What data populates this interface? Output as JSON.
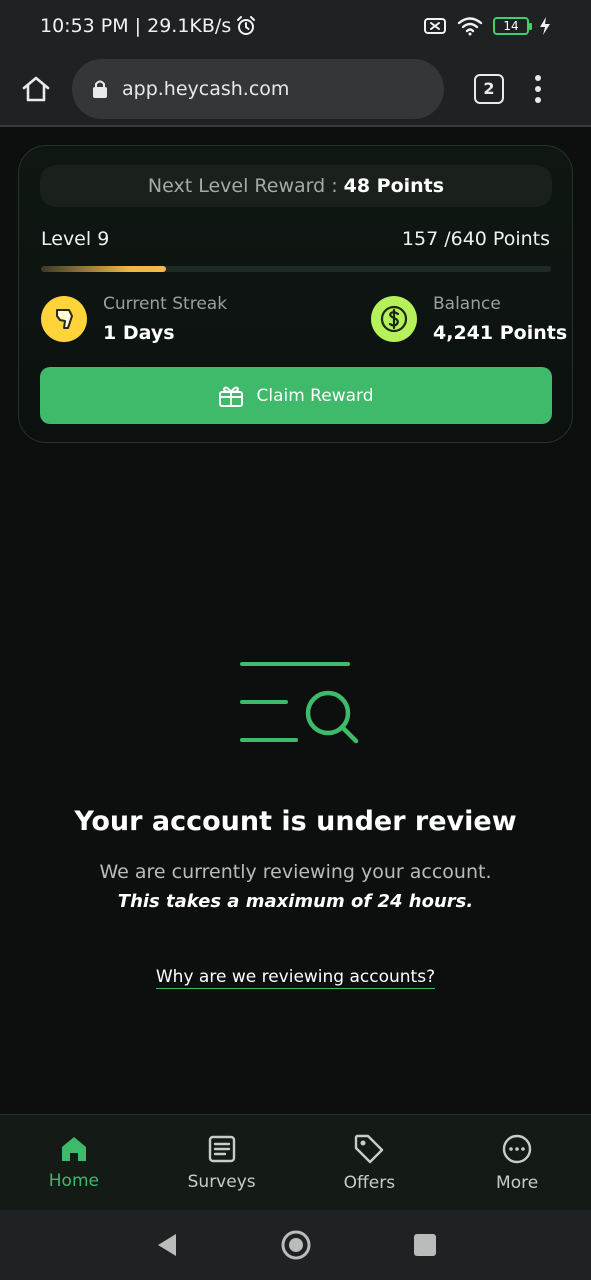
{
  "status_bar": {
    "time_speed": "10:53 PM | 29.1KB/s",
    "battery_level": "14"
  },
  "browser": {
    "url": "app.heycash.com",
    "tab_count": "2"
  },
  "reward_card": {
    "next_level_label": "Next Level Reward :",
    "next_level_value": "48 Points",
    "level_label": "Level 9",
    "level_points": "157 /640 Points",
    "progress_fraction": 0.245,
    "streak_label": "Current Streak",
    "streak_value": "1 Days",
    "balance_label": "Balance",
    "balance_value": "4,241 Points",
    "claim_button": "Claim Reward"
  },
  "review": {
    "title": "Your account is under review",
    "description": "We are currently reviewing your account.",
    "note": "This takes a maximum of 24 hours.",
    "link": "Why are we reviewing accounts?"
  },
  "bottom_nav": {
    "items": [
      {
        "label": "Home",
        "icon": "home-icon",
        "active": true
      },
      {
        "label": "Surveys",
        "icon": "document-icon",
        "active": false
      },
      {
        "label": "Offers",
        "icon": "tag-icon",
        "active": false
      },
      {
        "label": "More",
        "icon": "more-circle-icon",
        "active": false
      }
    ]
  },
  "colors": {
    "accent": "#3fba6a",
    "progress": "#f7b84b",
    "streak_icon_bg": "#ffd43a",
    "balance_icon_bg": "#b6f05a"
  }
}
